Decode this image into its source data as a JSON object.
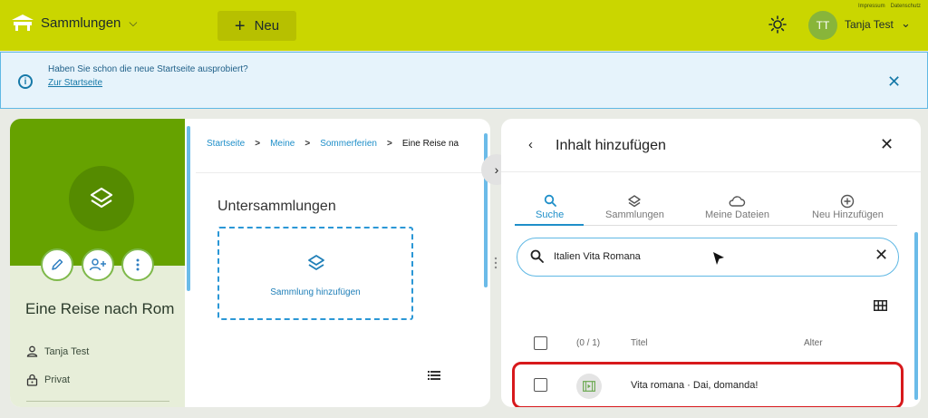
{
  "header": {
    "brand_label": "Sammlungen",
    "new_button_label": "Neu",
    "legal_links": [
      "Impressum",
      "Datenschutz"
    ],
    "user_initials": "TT",
    "user_name": "Tanja Test",
    "accent_color": "#cad600"
  },
  "banner": {
    "text": "Haben Sie schon die neue Startseite ausprobiert?",
    "link": "Zur Startseite"
  },
  "collection": {
    "title": "Eine Reise nach Rom",
    "owner": "Tanja Test",
    "visibility": "Privat",
    "breadcrumbs": [
      "Startseite",
      "Meine",
      "Sommerferien",
      "Eine Reise na"
    ],
    "subcollections_heading": "Untersammlungen",
    "add_subcollection_label": "Sammlung hinzufügen"
  },
  "panel": {
    "title": "Inhalt hinzufügen",
    "tabs": [
      {
        "label": "Suche",
        "icon": "search-icon"
      },
      {
        "label": "Sammlungen",
        "icon": "layers-icon"
      },
      {
        "label": "Meine Dateien",
        "icon": "cloud-icon"
      },
      {
        "label": "Neu Hinzufügen",
        "icon": "plus-circle-icon"
      }
    ],
    "search_value": "Italien Vita Romana",
    "table": {
      "count": "(0 / 1)",
      "col_title": "Titel",
      "col_age": "Alter",
      "rows": [
        {
          "title": "Vita romana · Dai, domanda!"
        }
      ]
    }
  }
}
